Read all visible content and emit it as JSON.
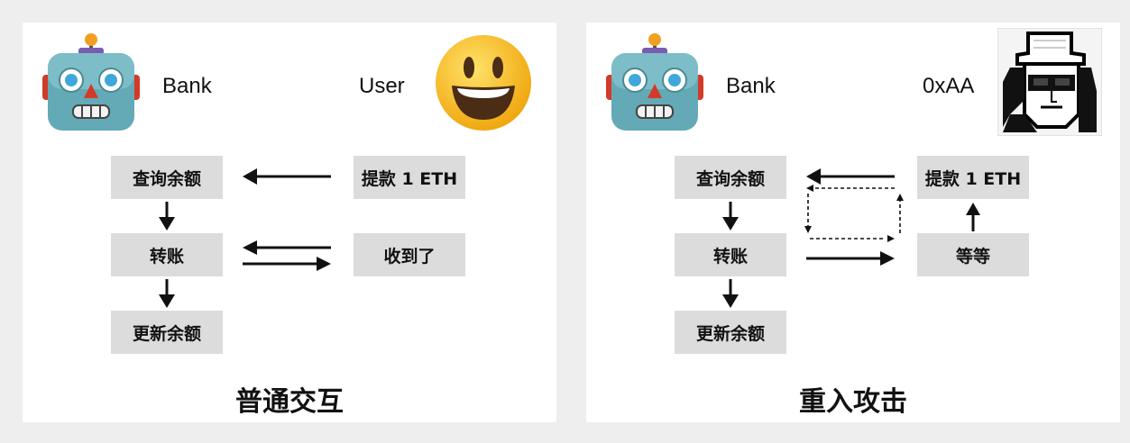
{
  "normal": {
    "bank_label": "Bank",
    "user_label": "User",
    "bank_steps": [
      "查询余额",
      "转账",
      "更新余额"
    ],
    "user_steps": [
      "提款 1 ETH",
      "收到了"
    ],
    "title": "普通交互"
  },
  "reentrancy": {
    "bank_label": "Bank",
    "attacker_label": "0xAA",
    "bank_steps": [
      "查询余额",
      "转账",
      "更新余额"
    ],
    "attacker_steps": [
      "提款 1 ETH",
      "等等"
    ],
    "title": "重入攻击"
  },
  "icons": {
    "bank": "robot-icon",
    "user": "smiley-face-icon",
    "attacker": "hat-glasses-avatar-icon"
  },
  "colors": {
    "background": "#eeeeee",
    "panel": "#ffffff",
    "box": "#dcdcdc",
    "arrow": "#111111",
    "robot_body": "#63a9b6",
    "smiley": "#f5b816"
  }
}
